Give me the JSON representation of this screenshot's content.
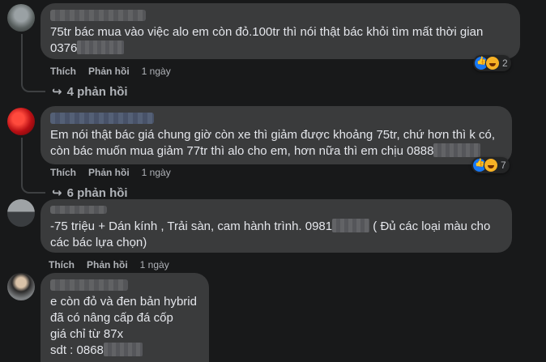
{
  "labels": {
    "like": "Thích",
    "reply": "Phản hồi"
  },
  "comments": [
    {
      "line1": "75tr bác mua vào việc alo em còn đỏ.100tr thì nói thật bác khỏi tìm mất thời gian",
      "line2_prefix": "0376",
      "time": "1 ngày",
      "reactions": "2",
      "replies": "4 phản hồi"
    },
    {
      "line1": "Em nói thật bác giá chung giờ còn xe thì giảm được khoảng 75tr, chứ hơn thì k có,",
      "line2_prefix": "còn bác muốn mua giảm 77tr thì alo cho em, hơn nữa thì em chịu  ",
      "line2_phone": "0888",
      "time": "1 ngày",
      "reactions": "7",
      "replies": "6 phản hồi"
    },
    {
      "line1_prefix": "-75 triệu + Dán kính , Trải sàn, cam hành trình. 0981",
      "line1_suffix": "  ( Đủ các loại màu cho",
      "line2": "các bác lựa chọn)",
      "time": "1 ngày"
    },
    {
      "line1": "e còn đỏ và đen bản hybrid",
      "line2": "đã có nâng cấp đá cốp",
      "line3": "giá chỉ từ 87x",
      "line4_prefix": "sdt : 0868"
    }
  ],
  "colors": {
    "bg": "#18191a",
    "bubble": "#3a3b3c",
    "text": "#e4e6eb",
    "muted": "#b0b3b8"
  }
}
